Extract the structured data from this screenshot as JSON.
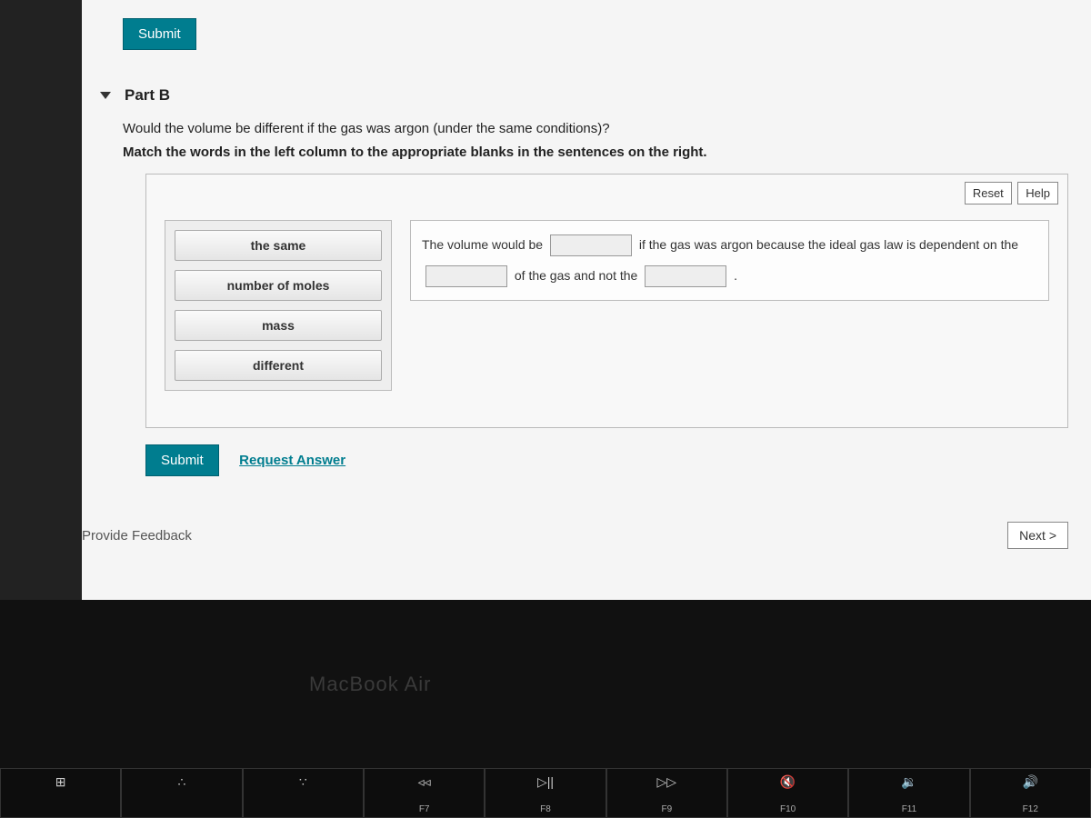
{
  "top_submit": "Submit",
  "part": {
    "title": "Part B",
    "question": "Would the volume be different if the gas was argon (under the same conditions)?",
    "instruction": "Match the words in the left column to the appropriate blanks in the sentences on the right."
  },
  "toolbar": {
    "reset": "Reset",
    "help": "Help"
  },
  "words": [
    "the same",
    "number of moles",
    "mass",
    "different"
  ],
  "sentence": {
    "s1": "The volume would be",
    "s2": "if the gas was argon because the ideal gas law is dependent on",
    "s3": "the",
    "s4": "of the gas and not the",
    "s5": "."
  },
  "actions": {
    "submit": "Submit",
    "request": "Request Answer"
  },
  "footer": {
    "feedback": "Provide Feedback",
    "next": "Next >"
  },
  "laptop": {
    "brand": "MacBook Air",
    "keys": [
      {
        "icon": "⊞",
        "label": ""
      },
      {
        "icon": "∴",
        "label": ""
      },
      {
        "icon": "∵",
        "label": ""
      },
      {
        "icon": "◃◃",
        "label": "F7"
      },
      {
        "icon": "▷||",
        "label": "F8"
      },
      {
        "icon": "▷▷",
        "label": "F9"
      },
      {
        "icon": "🔇",
        "label": "F10"
      },
      {
        "icon": "🔉",
        "label": "F11"
      },
      {
        "icon": "🔊",
        "label": "F12"
      }
    ]
  }
}
